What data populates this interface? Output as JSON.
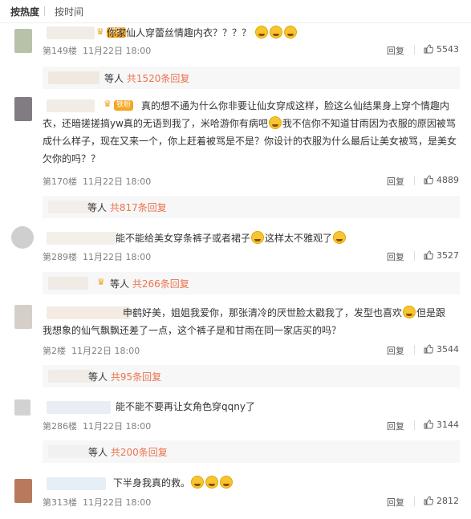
{
  "tabs": {
    "hot": "按热度",
    "time": "按时间"
  },
  "comments": [
    {
      "text": "你家仙人穿蕾丝情趣内衣？？？？",
      "badge": "铁粉",
      "floor": "第149楼",
      "date": "11月22日 18:00",
      "reply_label": "回复",
      "likes": "5543",
      "subs": {
        "suffix": "等人",
        "count": "共1520条回复"
      }
    },
    {
      "text_a": "真的想不通为什么你非要让仙女穿成这样，脸这么仙结果身上穿个情趣内",
      "text_b": "衣，还暗搓搓搞yw真的无语到我了，米哈游你有病吧",
      "text_b2": "我不信你不知道甘雨因为衣服的原因被骂",
      "text_c": "成什么样子，现在又来一个，你上赶着被骂是不是？你设计的衣服为什么最后让美女被骂，是美女",
      "text_d": "欠你的吗？？",
      "badge": "铁粉",
      "floor": "第170楼",
      "date": "11月22日 18:00",
      "reply_label": "回复",
      "likes": "4889",
      "subs": {
        "suffix": "等人",
        "count": "共817条回复"
      }
    },
    {
      "text_a": "能不能给美女穿条裤子或者裙子",
      "text_b": "这样太不雅观了",
      "floor": "第289楼",
      "date": "11月22日 18:00",
      "reply_label": "回复",
      "likes": "3527",
      "subs": {
        "suffix": "等人",
        "count": "共266条回复"
      }
    },
    {
      "text_a": "申鹤好美，姐姐我爱你，那张清冷的厌世脸太戳我了，发型也喜欢",
      "text_b": "但是跟",
      "text_c": "我想象的仙气飘飘还差了一点，这个裤子是和甘雨在同一家店买的吗？",
      "floor": "第2楼",
      "date": "11月22日 18:00",
      "reply_label": "回复",
      "likes": "3544",
      "subs": {
        "suffix": "等人",
        "count": "共95条回复"
      }
    },
    {
      "text": "能不能不要再让女角色穿qqny了",
      "floor": "第286楼",
      "date": "11月22日 18:00",
      "reply_label": "回复",
      "likes": "3144",
      "subs": {
        "suffix": "等人",
        "count": "共200条回复"
      }
    },
    {
      "text": "下半身我真的救。",
      "floor": "第313楼",
      "date": "11月22日 18:00",
      "reply_label": "回复",
      "likes": "2812"
    }
  ]
}
